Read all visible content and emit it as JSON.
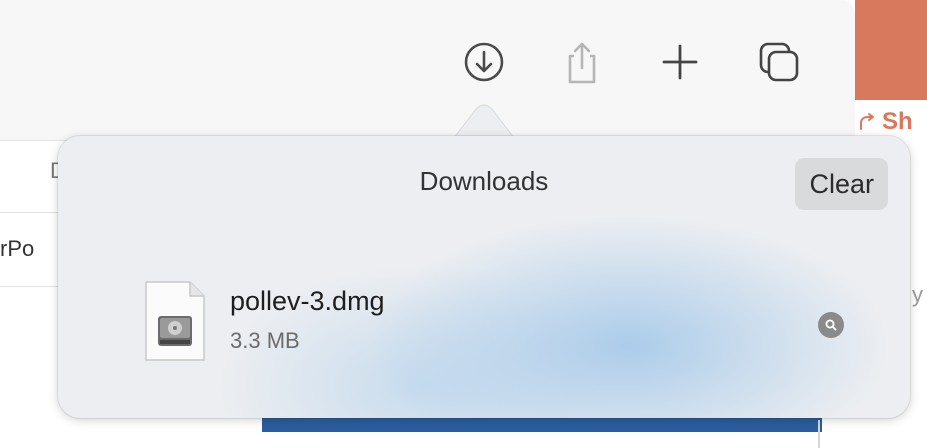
{
  "toolbar": {
    "icons": [
      "download-icon",
      "share-icon",
      "plus-icon",
      "tabs-icon"
    ]
  },
  "background": {
    "right_hint": "Sh",
    "left_hint_top": "D",
    "left_hint_bottom": "rPo",
    "right_hint_low": "y"
  },
  "downloads": {
    "title": "Downloads",
    "clear_label": "Clear",
    "items": [
      {
        "name": "pollev-3.dmg",
        "size": "3.3 MB",
        "icon": "disk-image-file-icon",
        "action_icon": "magnifier-icon"
      }
    ]
  },
  "colors": {
    "accent_orange": "#d8785c",
    "blue_bar": "#2b5d9e",
    "popover_bg": "#eceef1"
  }
}
